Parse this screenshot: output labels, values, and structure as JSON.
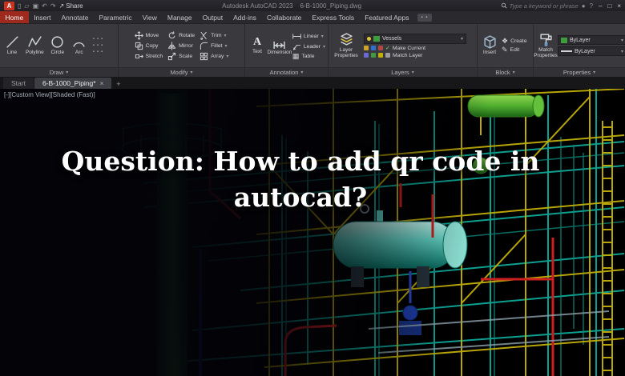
{
  "colors": {
    "tab_active_red": "#9e2a1e",
    "vessels_green": "#3f9b3f",
    "pipe_teal": "#0fae9e",
    "steel_yellow": "#c2ae08",
    "pipe_red": "#cc1f1f"
  },
  "icons": {
    "app_logo": "A",
    "new": "▯",
    "open": "▱",
    "save": "▣",
    "undo": "↶",
    "redo": "↷",
    "share_arrow": "↗",
    "minimize": "–",
    "maximize": "□",
    "close": "×",
    "chevron_down": "▾",
    "plus": "+",
    "check": "✓",
    "pencil": "✎",
    "table": "▦",
    "diamond": "❖",
    "text_glyph": "A",
    "dots": "▪ ▪",
    "tiny_square": "▪"
  },
  "titlebar": {
    "share_label": "Share",
    "app_title": "Autodesk AutoCAD 2023",
    "doc_title": "6-B-1000_Piping.dwg",
    "search_placeholder": "Type a keyword or phrase"
  },
  "ribbon_tabs": [
    {
      "label": "Home"
    },
    {
      "label": "Insert"
    },
    {
      "label": "Annotate"
    },
    {
      "label": "Parametric"
    },
    {
      "label": "View"
    },
    {
      "label": "Manage"
    },
    {
      "label": "Output"
    },
    {
      "label": "Add-ins"
    },
    {
      "label": "Collaborate"
    },
    {
      "label": "Express Tools"
    },
    {
      "label": "Featured Apps"
    }
  ],
  "panels": {
    "draw": {
      "label": "Draw",
      "items": [
        "Line",
        "Polyline",
        "Circle",
        "Arc"
      ]
    },
    "modify": {
      "label": "Modify",
      "items": [
        "Move",
        "Rotate",
        "Trim",
        "Copy",
        "Mirror",
        "Fillet",
        "Stretch",
        "Scale",
        "Array"
      ]
    },
    "annotation": {
      "label": "Annotation",
      "big": [
        "Text",
        "Dimension"
      ],
      "small": [
        "Linear",
        "Leader",
        "Table"
      ]
    },
    "layers": {
      "label": "Layers",
      "big": "Layer Properties",
      "dropdown_value": "Vessels",
      "actions": [
        "Make Current",
        "Match Layer"
      ]
    },
    "block": {
      "label": "Block",
      "big": "Insert",
      "small": [
        "Create",
        "Edit"
      ]
    },
    "properties": {
      "label": "Properties",
      "big": "Match Properties",
      "rows": [
        "ByLayer",
        "ByLayer"
      ]
    }
  },
  "file_tabs": {
    "start": "Start",
    "active": "6-B-1000_Piping*"
  },
  "viewport": {
    "controls": "[-][Custom View][Shaded (Fast)]"
  },
  "overlay": {
    "line1": "Question: How to add qr code in",
    "line2": "autocad?"
  }
}
